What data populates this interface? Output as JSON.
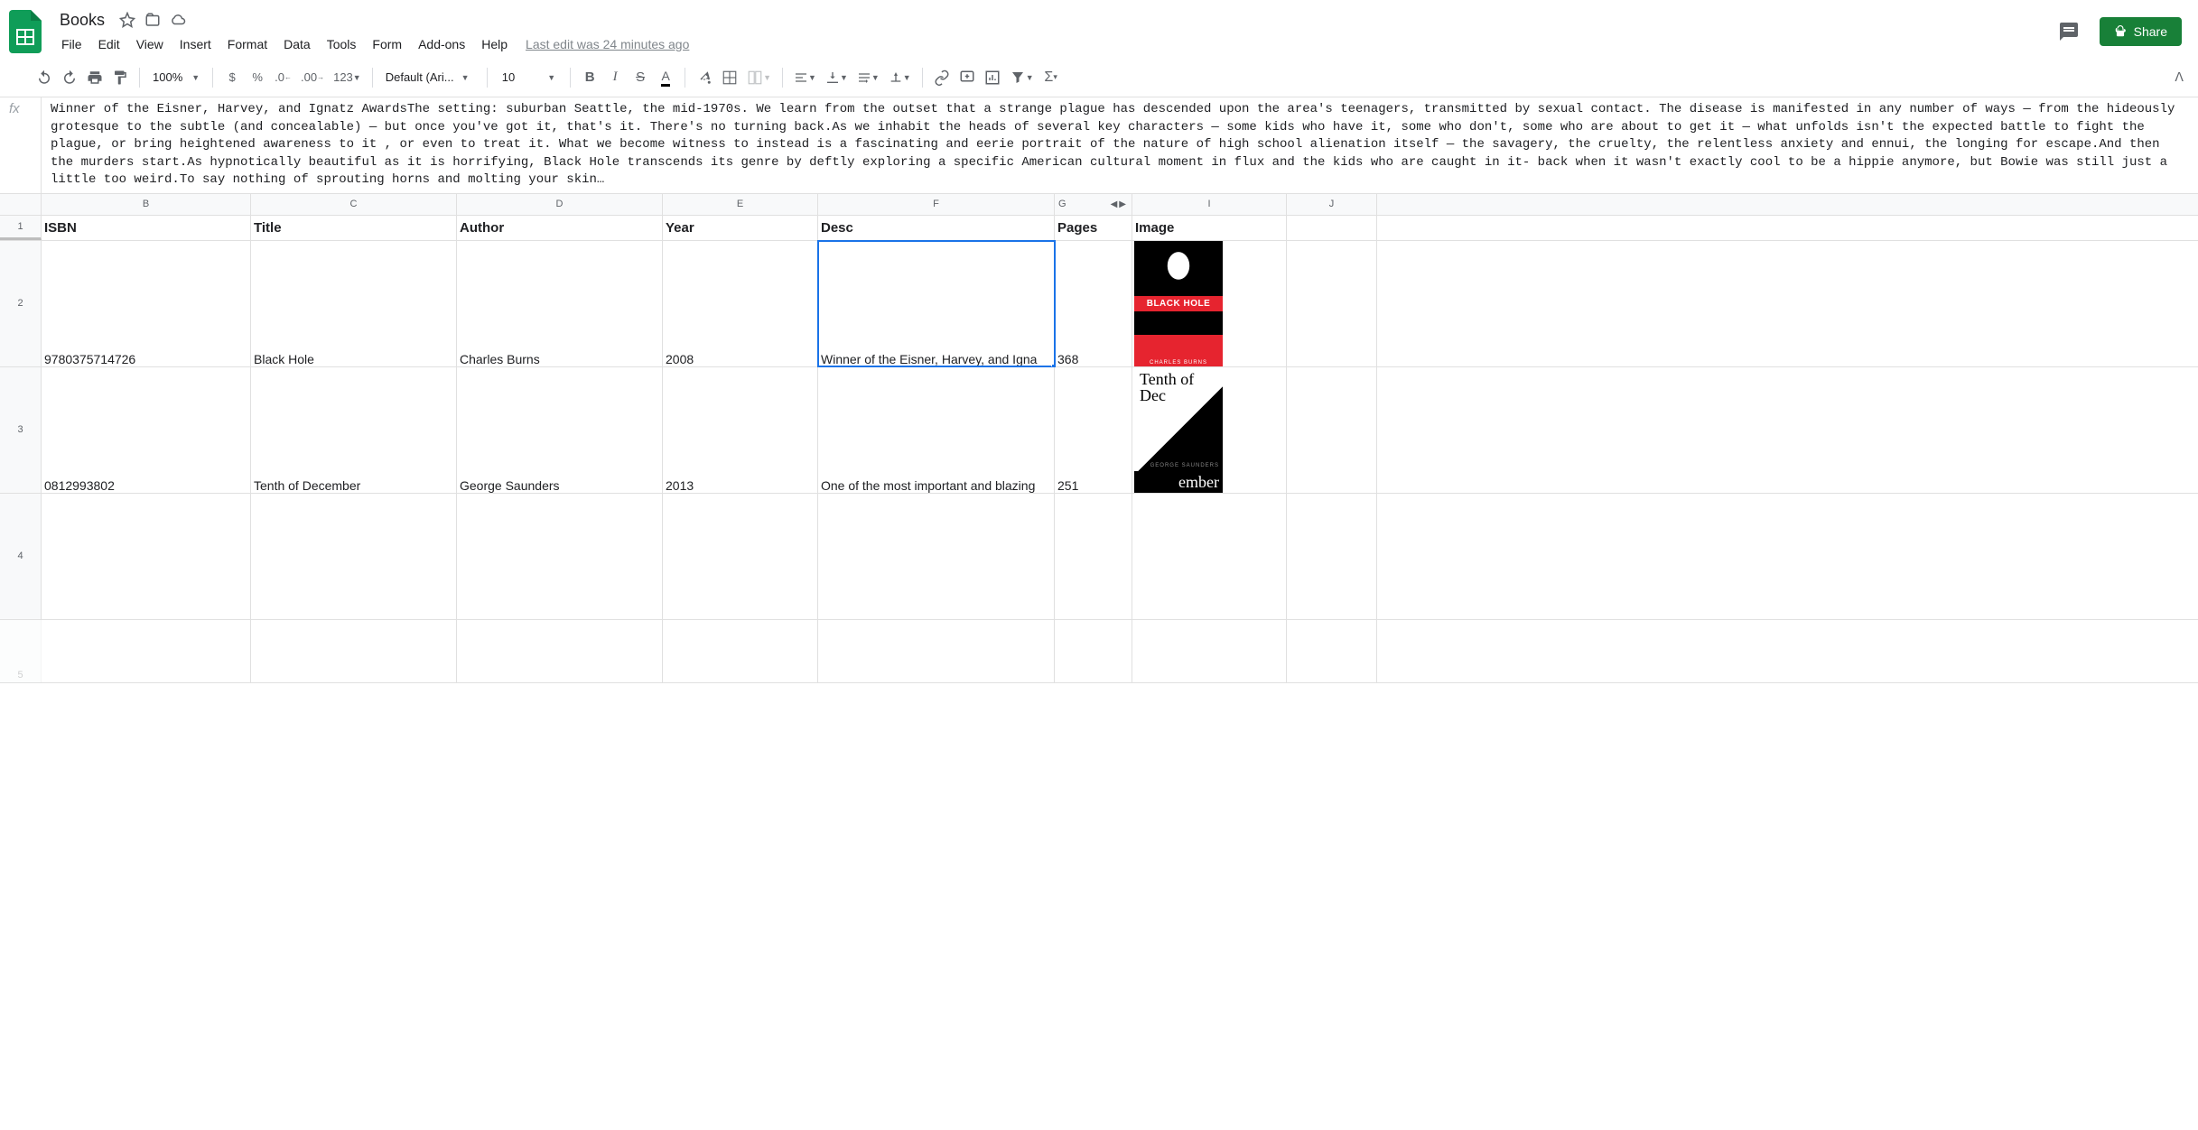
{
  "doc": {
    "title": "Books",
    "last_edit": "Last edit was 24 minutes ago"
  },
  "menus": {
    "file": "File",
    "edit": "Edit",
    "view": "View",
    "insert": "Insert",
    "format": "Format",
    "data": "Data",
    "tools": "Tools",
    "form": "Form",
    "addons": "Add-ons",
    "help": "Help"
  },
  "header_actions": {
    "share": "Share"
  },
  "toolbar": {
    "zoom": "100%",
    "currency": "$",
    "percent": "%",
    "dec_dec": ".0",
    "inc_dec": ".00",
    "num_format": "123",
    "font": "Default (Ari...",
    "size": "10"
  },
  "formula_bar": {
    "fx": "fx",
    "content": "Winner of the Eisner, Harvey, and Ignatz AwardsThe setting: suburban Seattle, the mid-1970s. We learn from the outset that a strange plague has descended upon the area's teenagers, transmitted by sexual contact. The disease is manifested in any number of ways — from the hideously grotesque to the subtle (and concealable) — but once you've got it, that's it. There's no turning back.As we inhabit the heads of several key characters — some kids who have it, some who don't, some who are about to get it — what unfolds isn't the expected battle to fight the plague, or bring heightened awareness to it , or even to treat it. What we become witness to instead is a fascinating and eerie portrait of the nature of high school alienation itself — the savagery, the cruelty, the relentless anxiety and ennui, the longing for escape.And then the murders start.As hypnotically beautiful as it is horrifying, Black Hole transcends its genre by deftly exploring a specific American cultural moment in flux and the kids who are caught in it- back when it wasn't exactly cool to be a hippie anymore, but Bowie was still just a little too weird.To say nothing of sprouting horns and molting your skin…"
  },
  "columns": {
    "b": "B",
    "c": "C",
    "d": "D",
    "e": "E",
    "f": "F",
    "g": "G",
    "i": "I",
    "j": "J"
  },
  "grid": {
    "headers": {
      "isbn": "ISBN",
      "title": "Title",
      "author": "Author",
      "year": "Year",
      "desc": "Desc",
      "pages": "Pages",
      "image": "Image"
    },
    "rows": [
      {
        "n": "1"
      },
      {
        "n": "2",
        "isbn": "9780375714726",
        "title": "Black Hole",
        "author": "Charles Burns",
        "year": "2008",
        "desc": "Winner of the Eisner, Harvey, and Igna",
        "pages": "368",
        "cover_title": "BLACK HOLE",
        "cover_author": "CHARLES BURNS"
      },
      {
        "n": "3",
        "isbn": "0812993802",
        "title": "Tenth of December",
        "author": "George Saunders",
        "year": "2013",
        "desc": "One of the most important and blazing",
        "pages": "251",
        "cover_title": "Tenth of Dec",
        "cover_author": "GEORGE SAUNDERS",
        "cover_suffix": "ember"
      },
      {
        "n": "4"
      },
      {
        "n": "5"
      }
    ]
  }
}
